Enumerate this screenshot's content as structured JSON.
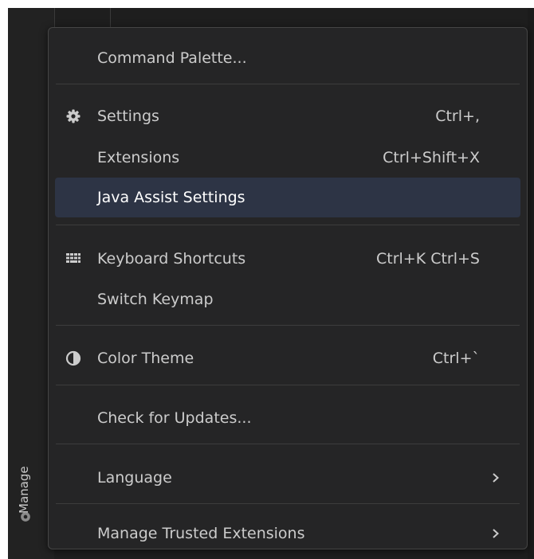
{
  "activity_bar": {
    "manage_label": "Manage"
  },
  "menu": {
    "items": [
      {
        "label": "Command Palette...",
        "shortcut": "",
        "icon": ""
      },
      {
        "label": "Settings",
        "shortcut": "Ctrl+,",
        "icon": "gear-icon"
      },
      {
        "label": "Extensions",
        "shortcut": "Ctrl+Shift+X",
        "icon": ""
      },
      {
        "label": "Java Assist Settings",
        "shortcut": "",
        "icon": "",
        "active": true
      },
      {
        "label": "Keyboard Shortcuts",
        "shortcut": "Ctrl+K Ctrl+S",
        "icon": "keyboard-icon"
      },
      {
        "label": "Switch Keymap",
        "shortcut": "",
        "icon": ""
      },
      {
        "label": "Color Theme",
        "shortcut": "Ctrl+`",
        "icon": "color-theme-icon"
      },
      {
        "label": "Check for Updates...",
        "shortcut": "",
        "icon": ""
      },
      {
        "label": "Language",
        "shortcut": "",
        "icon": "",
        "submenu": true
      },
      {
        "label": "Manage Trusted Extensions",
        "shortcut": "",
        "icon": "",
        "submenu": true
      }
    ]
  },
  "colors": {
    "menu_background": "#252526",
    "active_item_background": "#2d3445",
    "text": "#cccccc",
    "separator": "#3d3d3d"
  }
}
